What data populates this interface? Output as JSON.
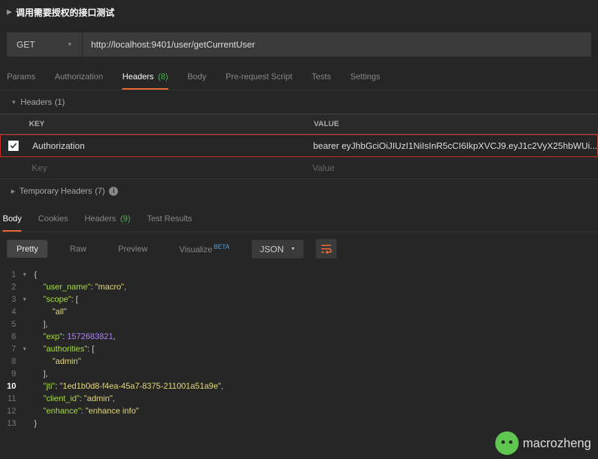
{
  "page_title": "调用需要授权的接口测试",
  "request": {
    "method": "GET",
    "url": "http://localhost:9401/user/getCurrentUser"
  },
  "tabs": {
    "params": "Params",
    "authorization": "Authorization",
    "headers": "Headers",
    "headers_count": "(8)",
    "body": "Body",
    "prerequest": "Pre-request Script",
    "tests": "Tests",
    "settings": "Settings"
  },
  "headers_section": {
    "label": "Headers",
    "count": "(1)",
    "th_key": "KEY",
    "th_value": "VALUE",
    "row_key": "Authorization",
    "row_value": "bearer eyJhbGciOiJIUzI1NiIsInR5cCI6IkpXVCJ9.eyJ1c2VyX25hbWUi...",
    "placeholder_key": "Key",
    "placeholder_value": "Value"
  },
  "temp_headers": {
    "label": "Temporary Headers",
    "count": "(7)"
  },
  "resp_tabs": {
    "body": "Body",
    "cookies": "Cookies",
    "headers": "Headers",
    "headers_count": "(9)",
    "test_results": "Test Results"
  },
  "toolbar": {
    "pretty": "Pretty",
    "raw": "Raw",
    "preview": "Preview",
    "visualize": "Visualize",
    "beta": "BETA",
    "format": "JSON"
  },
  "json_response": {
    "user_name": "macro",
    "scope": [
      "all"
    ],
    "exp": 1572683821,
    "authorities": [
      "admin"
    ],
    "jti": "1ed1b0d8-f4ea-45a7-8375-211001a51a9e",
    "client_id": "admin",
    "enhance": "enhance info"
  },
  "watermark": "macrozheng"
}
